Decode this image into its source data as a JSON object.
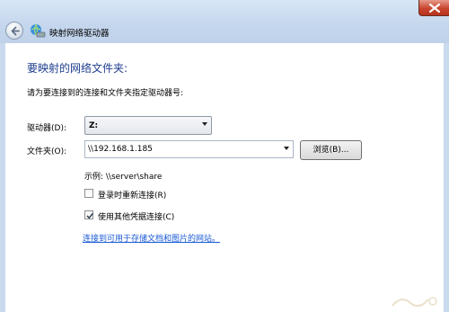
{
  "window": {
    "title": "映射网络驱动器"
  },
  "dialog": {
    "heading": "要映射的网络文件夹:",
    "description": "请为要连接到的连接和文件夹指定驱动器号:",
    "drive": {
      "label": "驱动器(D):",
      "value": "Z:"
    },
    "folder": {
      "label": "文件夹(O):",
      "value": "\\\\192.168.1.185",
      "browse_label": "浏览(B)..."
    },
    "example": "示例: \\\\server\\share",
    "reconnect": {
      "label": "登录时重新连接(R)",
      "checked": false
    },
    "other_credentials": {
      "label": "使用其他凭据连接(C)",
      "checked": true
    },
    "link_text": "连接到可用于存储文档和图片的网站。"
  },
  "icons": {
    "close": "close-icon",
    "back": "back-arrow-icon",
    "network": "network-drive-icon",
    "dropdown": "chevron-down-icon",
    "check": "checkmark-icon"
  },
  "colors": {
    "heading": "#1e3d8f",
    "link": "#1a5ad6",
    "close_button": "#c7452f"
  }
}
